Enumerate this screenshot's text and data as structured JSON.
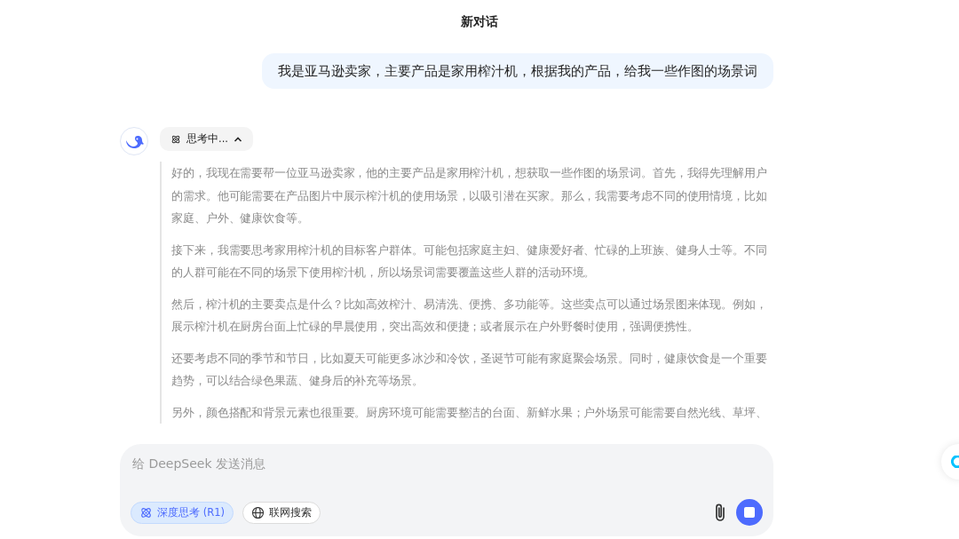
{
  "header": {
    "title": "新对话"
  },
  "user_message": {
    "text": "我是亚马逊卖家，主要产品是家用榨汁机，根据我的产品，给我一些作图的场景词"
  },
  "assistant": {
    "thinking_chip": {
      "label": "思考中...",
      "expanded": true
    },
    "thoughts": [
      "好的，我现在需要帮一位亚马逊卖家，他的主要产品是家用榨汁机，想获取一些作图的场景词。首先，我得先理解用户的需求。他可能需要在产品图片中展示榨汁机的使用场景，以吸引潜在买家。那么，我需要考虑不同的使用情境，比如家庭、户外、健康饮食等。",
      "接下来，我需要思考家用榨汁机的目标客户群体。可能包括家庭主妇、健康爱好者、忙碌的上班族、健身人士等。不同的人群可能在不同的场景下使用榨汁机，所以场景词需要覆盖这些人群的活动环境。",
      "然后，榨汁机的主要卖点是什么？比如高效榨汁、易清洗、便携、多功能等。这些卖点可以通过场景图来体现。例如，展示榨汁机在厨房台面上忙碌的早晨使用，突出高效和便捷；或者展示在户外野餐时使用，强调便携性。",
      "还要考虑不同的季节和节日，比如夏天可能更多冰沙和冷饮，圣诞节可能有家庭聚会场景。同时，健康饮食是一个重要趋势，可以结合绿色果蔬、健身后的补充等场景。",
      "另外，颜色搭配和背景元素也很重要。厨房环境可能需要整洁的台面、新鲜水果；户外场景可能需要自然光线、草坪、"
    ]
  },
  "composer": {
    "placeholder": "给 DeepSeek 发送消息",
    "generating": true,
    "toggles": [
      {
        "kind": "deepthink",
        "label": "深度思考 (R1)",
        "selected": true
      },
      {
        "kind": "search",
        "label": "联网搜索",
        "selected": false
      }
    ]
  }
}
